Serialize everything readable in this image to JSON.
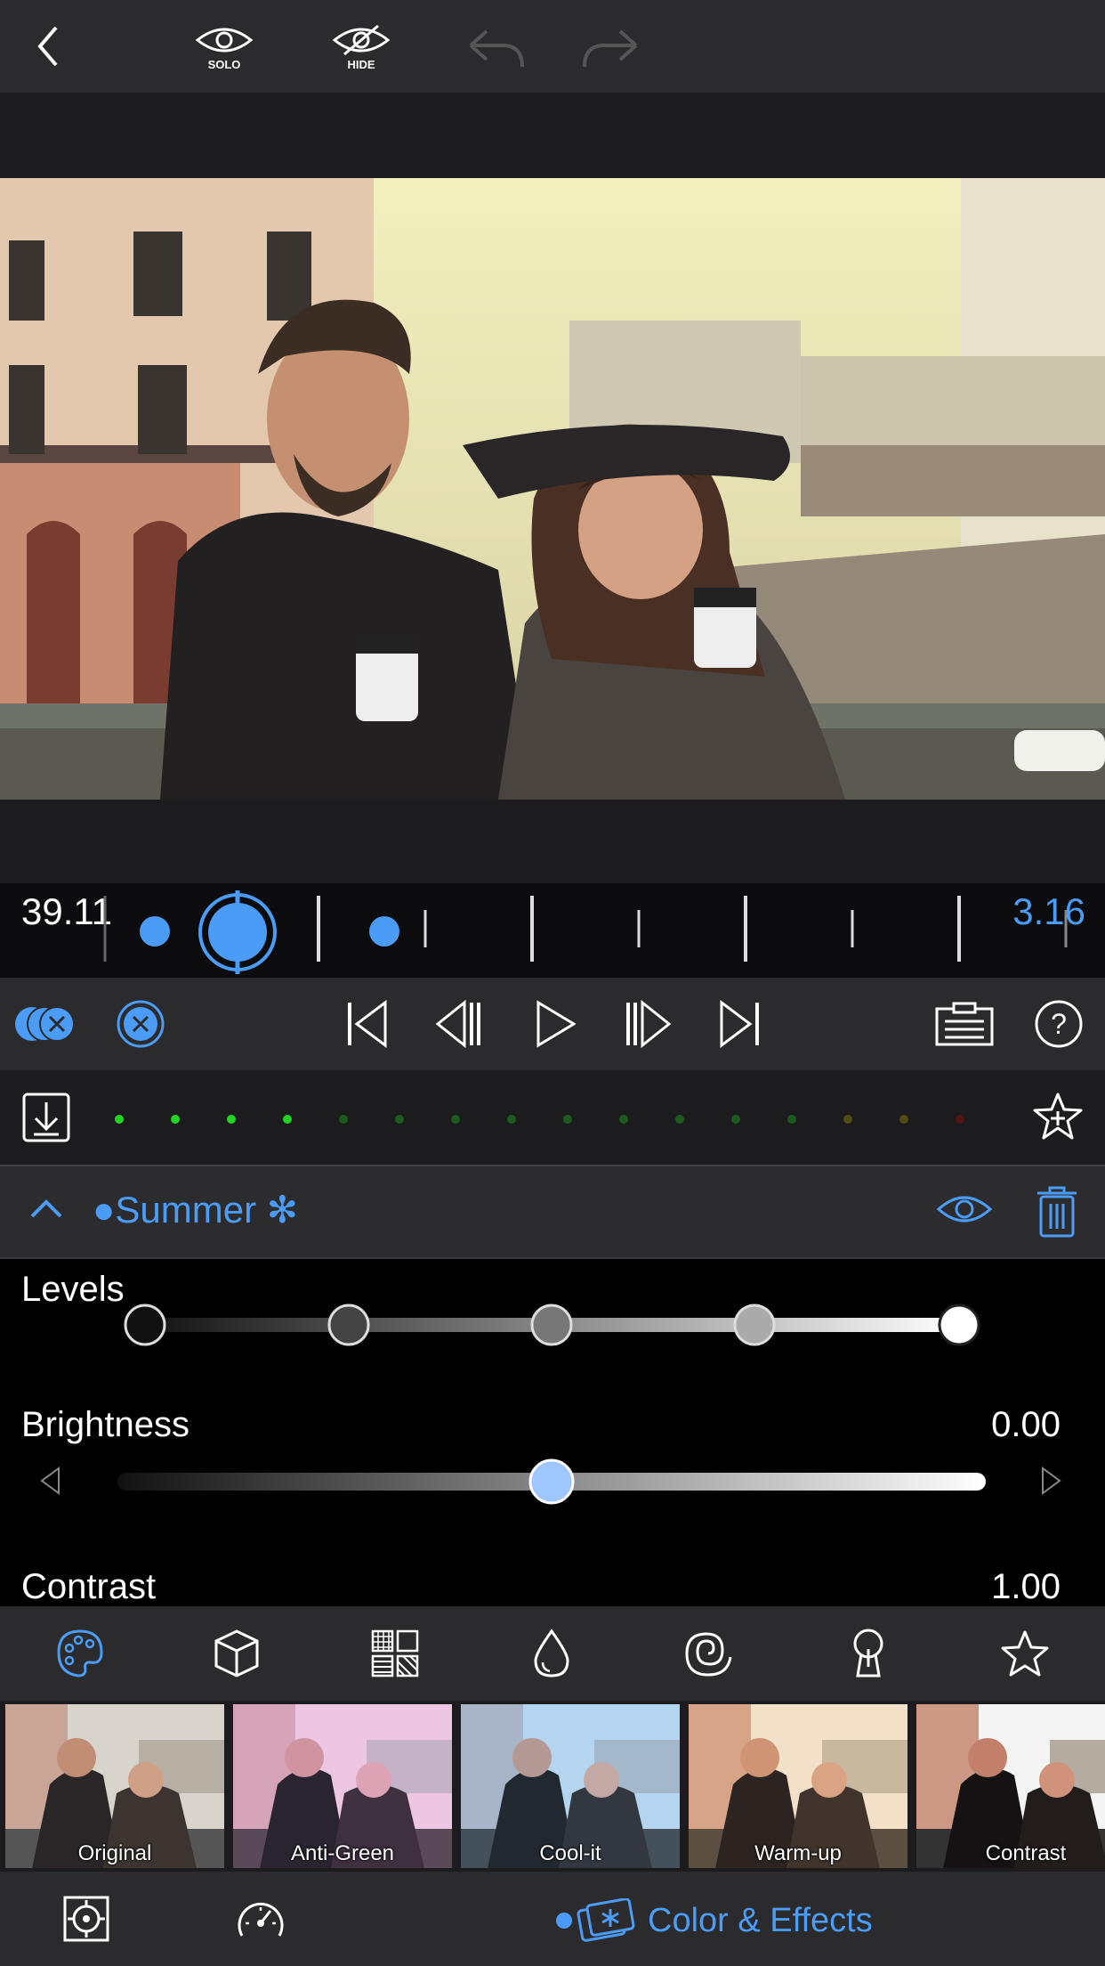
{
  "toolbar": {
    "solo_label": "SOLO",
    "hide_label": "HIDE"
  },
  "timeline": {
    "current_time": "39.11",
    "end_time": "3.16"
  },
  "layer": {
    "name": "●Summer ✻"
  },
  "adjustments": {
    "levels_label": "Levels",
    "brightness_label": "Brightness",
    "brightness_value": "0.00",
    "brightness_level": 0.5,
    "contrast_label": "Contrast",
    "contrast_value": "1.00"
  },
  "presets": [
    {
      "label": "Original"
    },
    {
      "label": "Anti-Green"
    },
    {
      "label": "Cool-it"
    },
    {
      "label": "Warm-up"
    },
    {
      "label": "Contrast"
    }
  ],
  "bottom": {
    "mode_label": "Color & Effects"
  },
  "colors": {
    "accent": "#4a9cf6",
    "panel": "#2b2b2d"
  },
  "icons": [
    "back-icon",
    "solo-eye-icon",
    "hide-eye-icon",
    "undo-icon",
    "redo-icon",
    "palette-icon",
    "cube-icon",
    "grid-icon",
    "drop-icon",
    "spiral-icon",
    "keyhole-icon",
    "star-icon"
  ]
}
